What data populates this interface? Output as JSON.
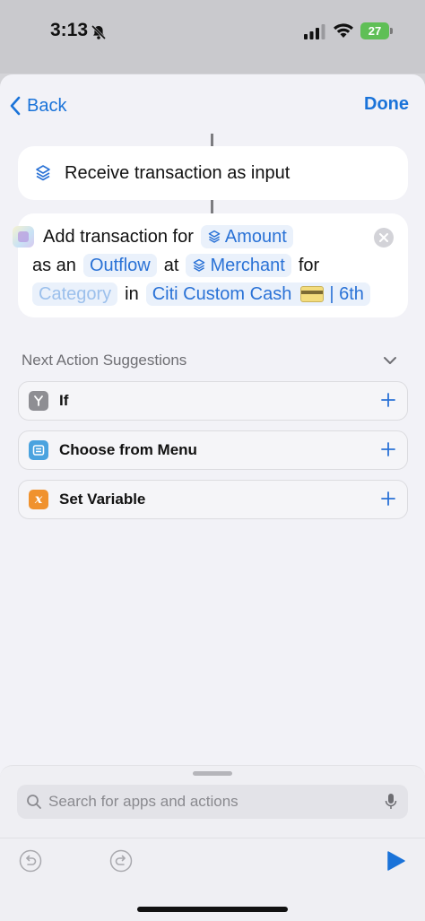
{
  "status_bar": {
    "time": "3:13",
    "battery": "27"
  },
  "nav": {
    "back_label": "Back",
    "done_label": "Done"
  },
  "receive_action": {
    "text": "Receive transaction as input",
    "icon": "shortcuts-input-icon"
  },
  "add_action": {
    "w_add": "Add transaction for",
    "amount": "Amount",
    "w_as_an": "as an",
    "outflow": "Outflow",
    "w_at": "at",
    "merchant": "Merchant",
    "w_for": "for",
    "category": "Category",
    "w_in": "in",
    "account": "Citi Custom Cash",
    "account_suffix": "| 6th",
    "icon": "app-icon"
  },
  "suggestions": {
    "header": "Next Action Suggestions",
    "items": [
      {
        "label": "If",
        "icon": "branch-icon",
        "color": "#8e8e93"
      },
      {
        "label": "Choose from Menu",
        "icon": "menu-icon",
        "color": "#4aa3df"
      },
      {
        "label": "Set Variable",
        "icon": "variable-icon",
        "glyph": "x",
        "color": "#f0922e"
      }
    ]
  },
  "search": {
    "placeholder": "Search for apps and actions"
  },
  "colors": {
    "accent": "#1a73d9",
    "pill_bg": "#eaf1fb",
    "sheet_bg": "#f2f2f7"
  }
}
